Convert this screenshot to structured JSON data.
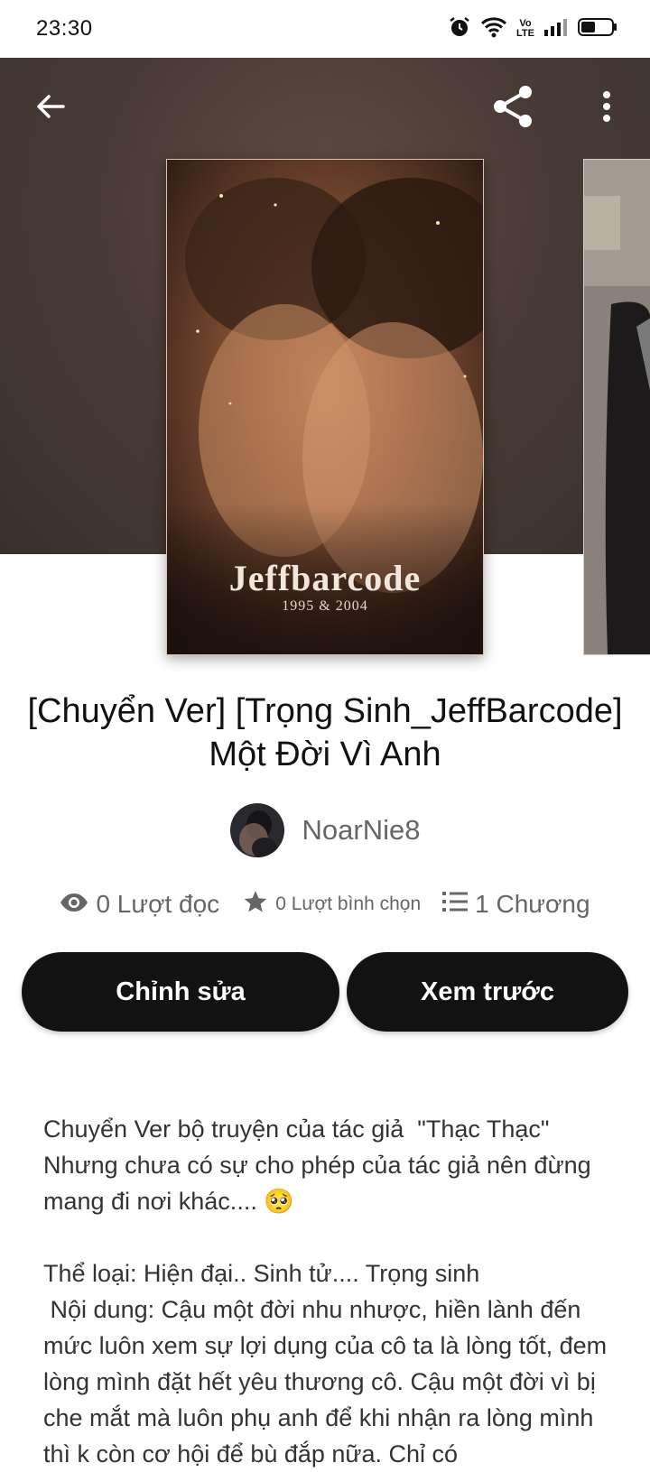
{
  "status_bar": {
    "time": "23:30",
    "icons": [
      "alarm-icon",
      "wifi-icon",
      "volte-icon",
      "signal-icon",
      "battery-icon"
    ],
    "volte_text": "Vo\nLTE"
  },
  "header": {
    "back_icon": "arrow-left-icon",
    "share_icon": "share-icon",
    "more_icon": "more-vertical-icon"
  },
  "cover": {
    "title_text": "Jeffbarcode",
    "subtitle_text": "1995 & 2004"
  },
  "story": {
    "title": "[Chuyển Ver] [Trọng Sinh_JeffBarcode] Một Đời Vì Anh",
    "author": "NoarNie8"
  },
  "stats": {
    "reads": "0 Lượt đọc",
    "votes": "0 Lượt bình chọn",
    "chapters": "1 Chương"
  },
  "actions": {
    "edit": "Chỉnh sửa",
    "preview": "Xem trước"
  },
  "description": {
    "intro": "Chuyển Ver bộ truyện của tác giả  \"Thạc Thạc\" Nhưng chưa có sự cho phép của tác giả nên đừng mang đi nơi khác.... 🥺",
    "genre": "Thể loại: Hiện đại.. Sinh tử.... Trọng sinh",
    "content": " Nội dung: Cậu một đời nhu nhược, hiền lành đến mức luôn xem sự lợi dụng của cô ta là lòng tốt, đem lòng mình đặt hết yêu thương cô. Cậu một đời vì bị che mắt mà luôn phụ anh để khi nhận ra lòng mình thì k còn cơ hội để bù đắp nữa. Chỉ có"
  },
  "colors": {
    "hero_bg": "#4a3c35",
    "button_bg": "#121212",
    "button_text": "#ffffff",
    "muted_text": "#666666"
  }
}
